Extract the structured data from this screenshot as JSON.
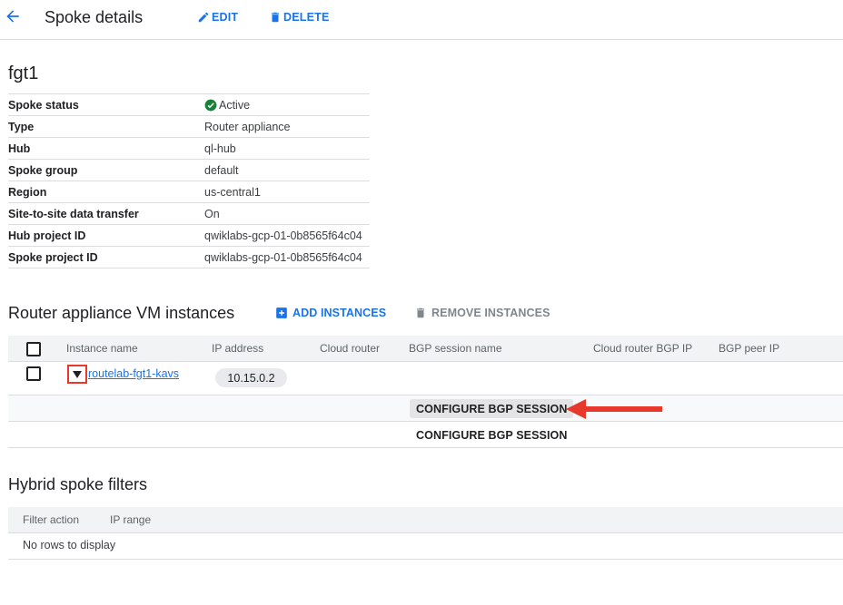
{
  "header": {
    "title": "Spoke details",
    "edit_label": "EDIT",
    "delete_label": "DELETE"
  },
  "spoke": {
    "name": "fgt1",
    "details": [
      {
        "key": "Spoke status",
        "value": "Active"
      },
      {
        "key": "Type",
        "value": "Router appliance"
      },
      {
        "key": "Hub",
        "value": "ql-hub"
      },
      {
        "key": "Spoke group",
        "value": "default"
      },
      {
        "key": "Region",
        "value": "us-central1"
      },
      {
        "key": "Site-to-site data transfer",
        "value": "On"
      },
      {
        "key": "Hub project ID",
        "value": "qwiklabs-gcp-01-0b8565f64c04"
      },
      {
        "key": "Spoke project ID",
        "value": "qwiklabs-gcp-01-0b8565f64c04"
      }
    ]
  },
  "router_vms": {
    "title": "Router appliance VM instances",
    "add_label": "ADD INSTANCES",
    "remove_label": "REMOVE INSTANCES",
    "columns": [
      "Instance name",
      "IP address",
      "Cloud router",
      "BGP session name",
      "Cloud router BGP IP",
      "BGP peer IP"
    ],
    "rows": [
      {
        "instance_name": "routelab-fgt1-kavs",
        "ip_address": "10.15.0.2"
      }
    ],
    "configure_bgp_label_1": "CONFIGURE BGP SESSION",
    "configure_bgp_label_2": "CONFIGURE BGP SESSION"
  },
  "hybrid_filters": {
    "title": "Hybrid spoke filters",
    "columns": [
      "Filter action",
      "IP range"
    ],
    "empty_text": "No rows to display"
  },
  "colors": {
    "accent": "#1a73e8",
    "status_active": "#188038",
    "annotation_red": "#e8382b"
  },
  "icons": [
    "arrow-back-icon",
    "pencil-icon",
    "trash-icon",
    "check-circle-icon",
    "plus-box-icon",
    "chevron-down-icon",
    "red-arrow-annotation"
  ]
}
